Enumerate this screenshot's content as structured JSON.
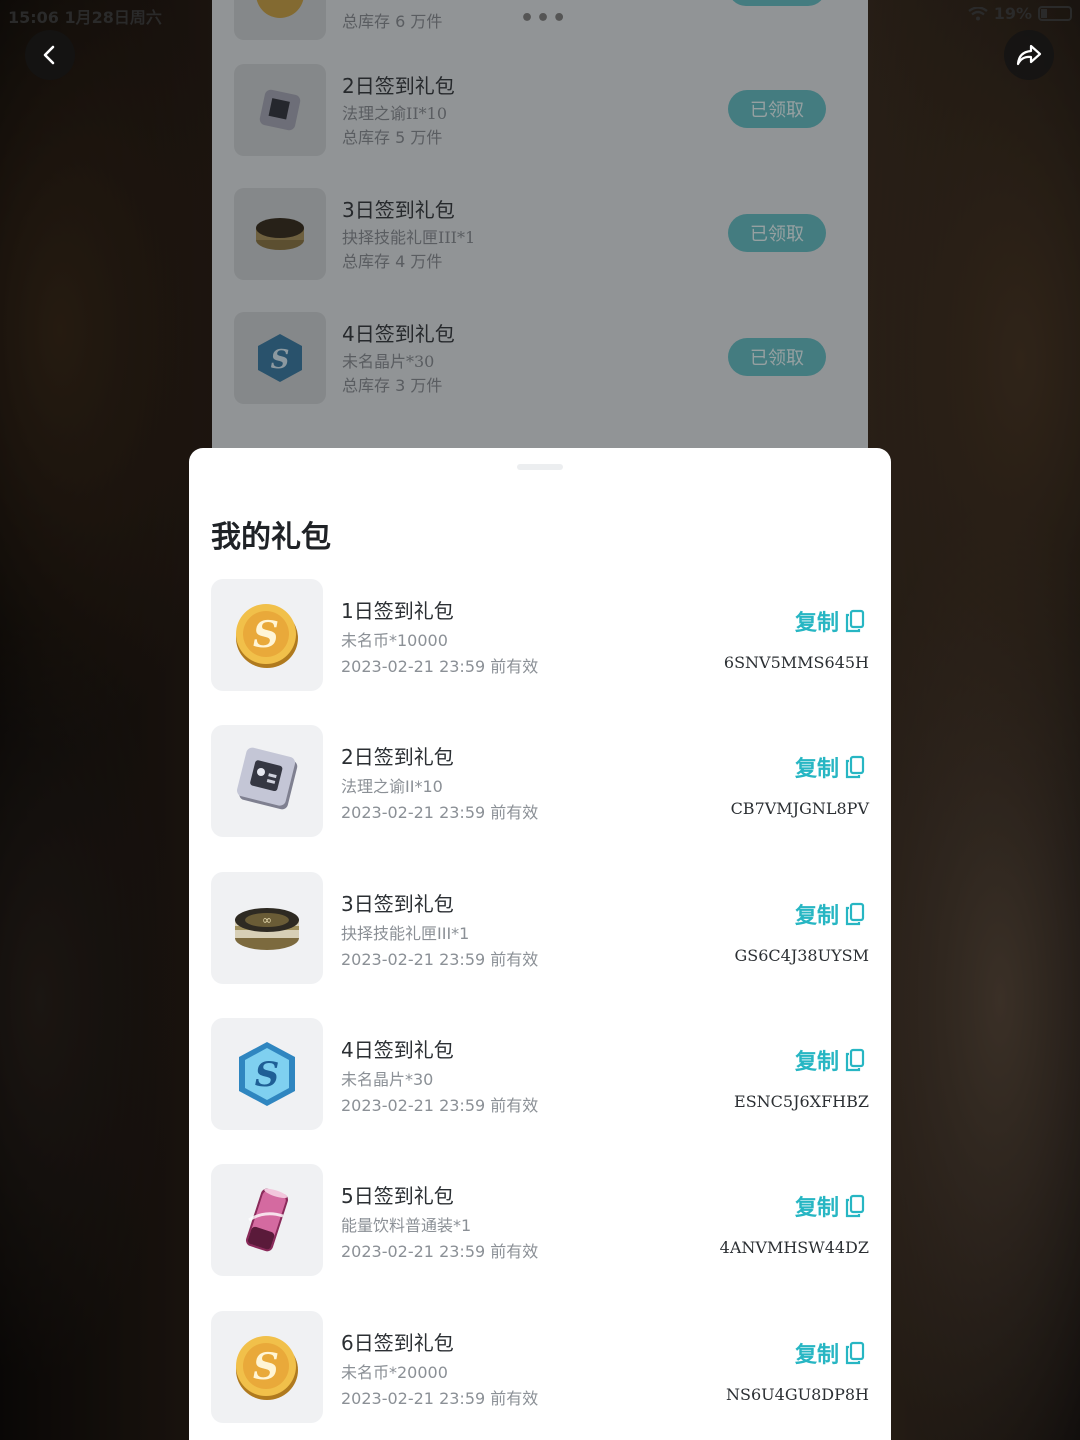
{
  "status_bar": {
    "time": "15:06   1月28日周六",
    "battery": "19%"
  },
  "background_page": {
    "rows": [
      {
        "title": "",
        "content": "",
        "stock": "总库存 6 万件",
        "button": ""
      },
      {
        "title": "2日签到礼包",
        "content": "法理之谕II*10",
        "stock": "总库存 5 万件",
        "button": "已领取"
      },
      {
        "title": "3日签到礼包",
        "content": "抉择技能礼匣III*1",
        "stock": "总库存 4 万件",
        "button": "已领取"
      },
      {
        "title": "4日签到礼包",
        "content": "未名晶片*30",
        "stock": "总库存 3 万件",
        "button": "已领取"
      }
    ]
  },
  "sheet": {
    "title": "我的礼包",
    "copy_label": "复制",
    "gifts": [
      {
        "title": "1日签到礼包",
        "content": "未名币*10000",
        "expire": "2023-02-21 23:59 前有效",
        "code": "6SNV5MMS645H",
        "icon": "gold-coin-icon"
      },
      {
        "title": "2日签到礼包",
        "content": "法理之谕II*10",
        "expire": "2023-02-21 23:59 前有效",
        "code": "CB7VMJGNL8PV",
        "icon": "silver-chip-icon"
      },
      {
        "title": "3日签到礼包",
        "content": "抉择技能礼匣III*1",
        "expire": "2023-02-21 23:59 前有效",
        "code": "GS6C4J38UYSM",
        "icon": "skill-box-icon"
      },
      {
        "title": "4日签到礼包",
        "content": "未名晶片*30",
        "expire": "2023-02-21 23:59 前有效",
        "code": "ESNC5J6XFHBZ",
        "icon": "blue-crystal-icon"
      },
      {
        "title": "5日签到礼包",
        "content": "能量饮料普通装*1",
        "expire": "2023-02-21 23:59 前有效",
        "code": "4ANVMHSW44DZ",
        "icon": "energy-drink-icon"
      },
      {
        "title": "6日签到礼包",
        "content": "未名币*20000",
        "expire": "2023-02-21 23:59 前有效",
        "code": "NS6U4GU8DP8H",
        "icon": "gold-coin-icon"
      }
    ]
  },
  "colors": {
    "accent": "#27b6c3",
    "claimed_button": "#69bfc5"
  }
}
